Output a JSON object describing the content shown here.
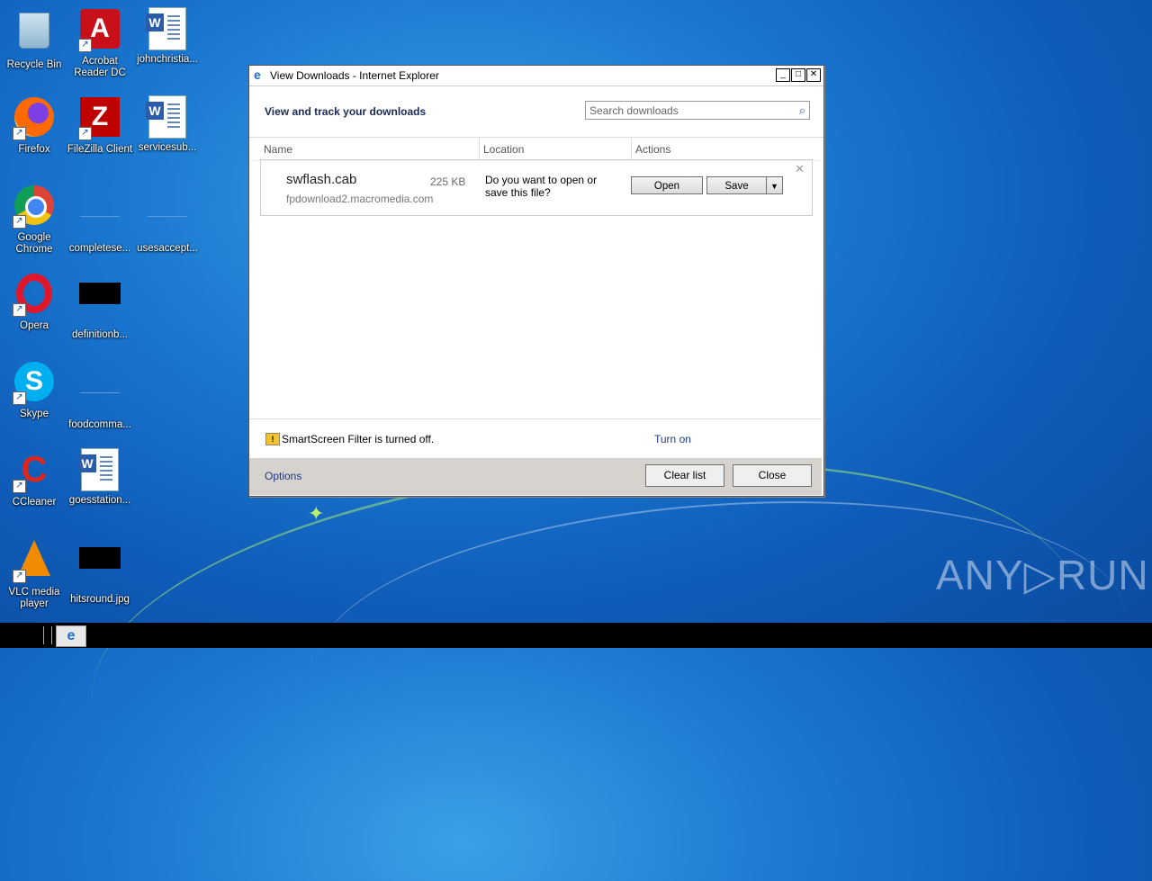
{
  "desktop": {
    "icons": [
      {
        "label": "Recycle Bin"
      },
      {
        "label": "Acrobat Reader DC"
      },
      {
        "label": "johnchristia..."
      },
      {
        "label": "Firefox"
      },
      {
        "label": "FileZilla Client"
      },
      {
        "label": "servicesub..."
      },
      {
        "label": "Google Chrome"
      },
      {
        "label": "completese..."
      },
      {
        "label": "usesaccept..."
      },
      {
        "label": "Opera"
      },
      {
        "label": "definitionb..."
      },
      {
        "label": "Skype"
      },
      {
        "label": "foodcomma..."
      },
      {
        "label": "CCleaner"
      },
      {
        "label": "goesstation..."
      },
      {
        "label": "VLC media player"
      },
      {
        "label": "hitsround.jpg"
      }
    ]
  },
  "window": {
    "title": "View Downloads - Internet Explorer",
    "heading": "View and track your downloads",
    "search_placeholder": "Search downloads",
    "columns": {
      "name": "Name",
      "location": "Location",
      "actions": "Actions"
    },
    "download": {
      "filename": "swflash.cab",
      "size": "225 KB",
      "source": "fpdownload2.macromedia.com",
      "prompt": "Do you want to open or save this file?",
      "open_label": "Open",
      "save_label": "Save"
    },
    "smartscreen": {
      "text": "SmartScreen Filter is turned off.",
      "turn_on": "Turn on"
    },
    "footer": {
      "options": "Options",
      "clear_list": "Clear list",
      "close": "Close"
    }
  },
  "watermark": "ANY▷RUN"
}
